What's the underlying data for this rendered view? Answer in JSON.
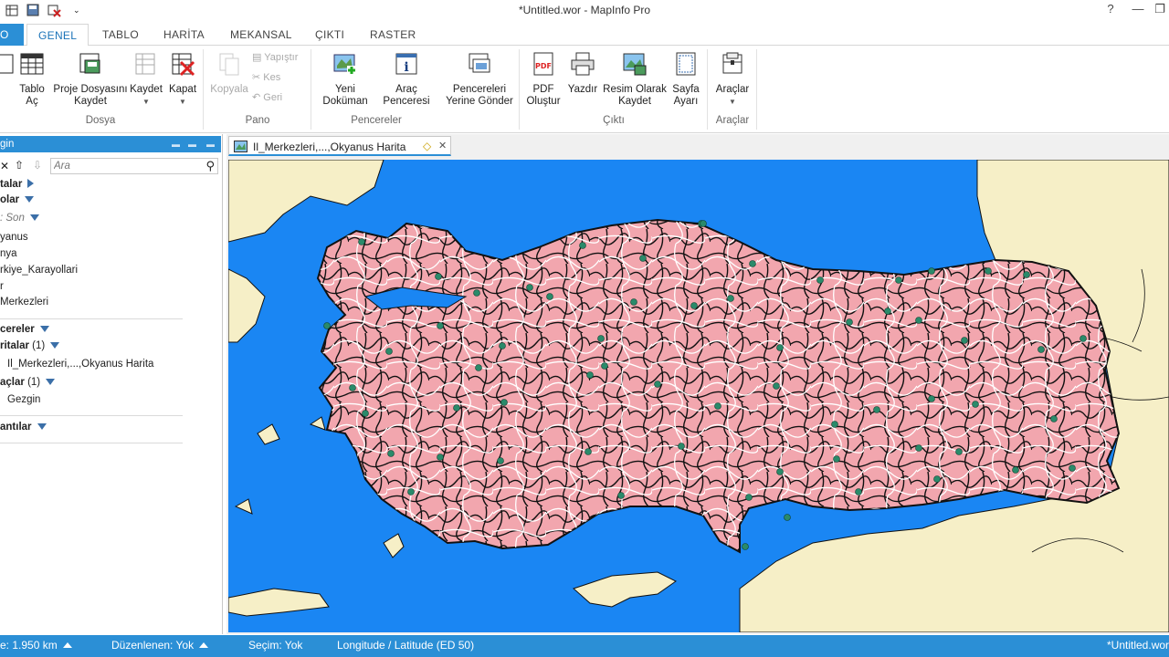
{
  "window": {
    "title": "*Untitled.wor - MapInfo Pro",
    "help": "?",
    "minimize": "—",
    "restore": "❐",
    "close": "✕"
  },
  "ribbon_tabs": [
    {
      "label": "O"
    },
    {
      "label": "GENEL"
    },
    {
      "label": "TABLO"
    },
    {
      "label": "HARİTA"
    },
    {
      "label": "MEKANSAL"
    },
    {
      "label": "ÇIKTI"
    },
    {
      "label": "RASTER"
    }
  ],
  "ribbon": {
    "tablo_ac": "Tablo\nAç",
    "proje_kaydet": "Proje Dosyasını\nKaydet",
    "kaydet": "Kaydet",
    "kapat": "Kapat",
    "kopyala": "Kopyala",
    "yapistir": "Yapıştır",
    "kes": "Kes",
    "geri": "Geri",
    "yeni_dokuman": "Yeni\nDoküman",
    "arac_penceresi": "Araç\nPenceresi",
    "pencereleri_yerine": "Pencereleri\nYerine Gönder",
    "pdf_olustur": "PDF\nOluştur",
    "yazdir": "Yazdır",
    "resim_olarak": "Resim Olarak\nKaydet",
    "sayfa_ayari": "Sayfa\nAyarı",
    "araclar": "Araçlar",
    "groups": {
      "dosya": "Dosya",
      "pano": "Pano",
      "pencereler": "Pencereler",
      "cikti": "Çıktı",
      "araclar": "Araçlar"
    }
  },
  "explorer": {
    "header": "gin",
    "search_placeholder": "Ara",
    "sections": {
      "haritalar_top": "talar",
      "tablolar": "olar",
      "sort": ": Son",
      "pencereler": "cereler",
      "haritalar": "ritalar",
      "haritalar_count": "(1)",
      "araclar": "açlar",
      "araclar_count": "(1)",
      "baglantilar": "antılar"
    },
    "tables": [
      "yanus",
      "nya",
      "rkiye_Karayollari",
      "r",
      "Merkezleri"
    ],
    "map_window": "Il_Merkezleri,...,Okyanus Harita",
    "tool_window": "Gezgin"
  },
  "map_tab": {
    "title": "Il_Merkezleri,...,Okyanus Harita",
    "close": "✕"
  },
  "status": {
    "zoom": "e: 1.950 km",
    "editing": "Düzenlenen: Yok",
    "selection": "Seçim: Yok",
    "projection": "Longitude / Latitude (ED 50)",
    "workspace": "*Untitled.wor"
  },
  "colors": {
    "accent": "#2b8fd6",
    "ocean": "#1a86f3",
    "land_outside": "#f6efc7",
    "turkey_fill": "#f2a6ae",
    "province_border": "#111111",
    "roads": "#ffffff",
    "city_points": "#2a8a6a"
  }
}
